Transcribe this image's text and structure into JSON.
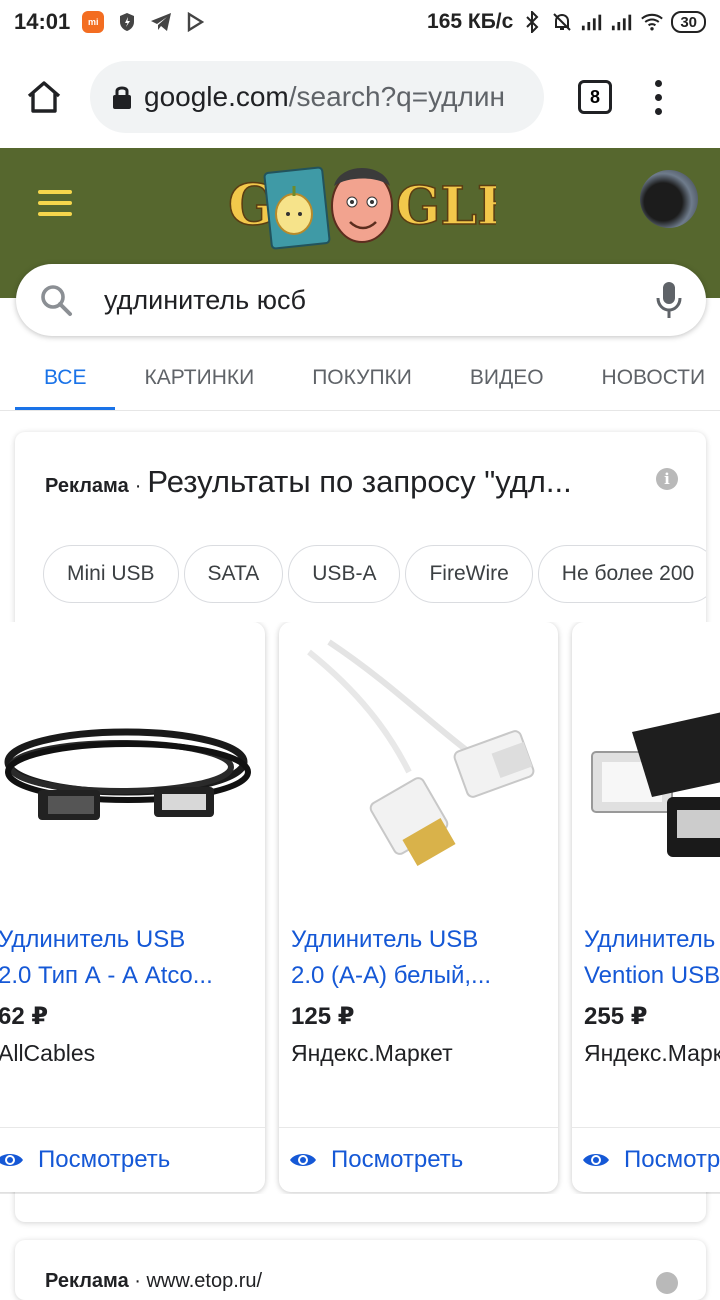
{
  "statusbar": {
    "time": "14:01",
    "net_speed": "165 КБ/с",
    "battery": "30"
  },
  "browser": {
    "url_domain": "google.com",
    "url_path": "/search?q=удлин",
    "tab_count": "8"
  },
  "search": {
    "query": "удлинитель юсб"
  },
  "tabs": [
    {
      "label": "ВСЕ",
      "active": true
    },
    {
      "label": "КАРТИНКИ"
    },
    {
      "label": "ПОКУПКИ"
    },
    {
      "label": "ВИДЕО"
    },
    {
      "label": "НОВОСТИ"
    }
  ],
  "ad": {
    "label": "Реклама",
    "heading": "Результаты по запросу \"удл...",
    "chips": [
      "Mini USB",
      "SATA",
      "USB-A",
      "FireWire",
      "Не более 200"
    ]
  },
  "products": [
    {
      "title_line1": "Удлинитель USB",
      "title_line2": "2.0 Тип А - А Atco...",
      "price": "62 ₽",
      "store": "AllCables",
      "action": "Посмотреть",
      "color": "black"
    },
    {
      "title_line1": "Удлинитель USB",
      "title_line2": "2.0 (A-A) белый,...",
      "price": "125 ₽",
      "store": "Яндекс.Маркет",
      "action": "Посмотреть",
      "color": "white"
    },
    {
      "title_line1": "Удлинитель",
      "title_line2": "Vention USB",
      "price": "255 ₽",
      "store": "Яндекс.Маркет",
      "action": "Посмотреть",
      "color": "black"
    }
  ],
  "next_ad": {
    "label": "Реклама",
    "url": "www.etop.ru/"
  },
  "colors": {
    "accent": "#1a73e8",
    "link": "#1558d6",
    "doodle_bg": "#56672e"
  }
}
